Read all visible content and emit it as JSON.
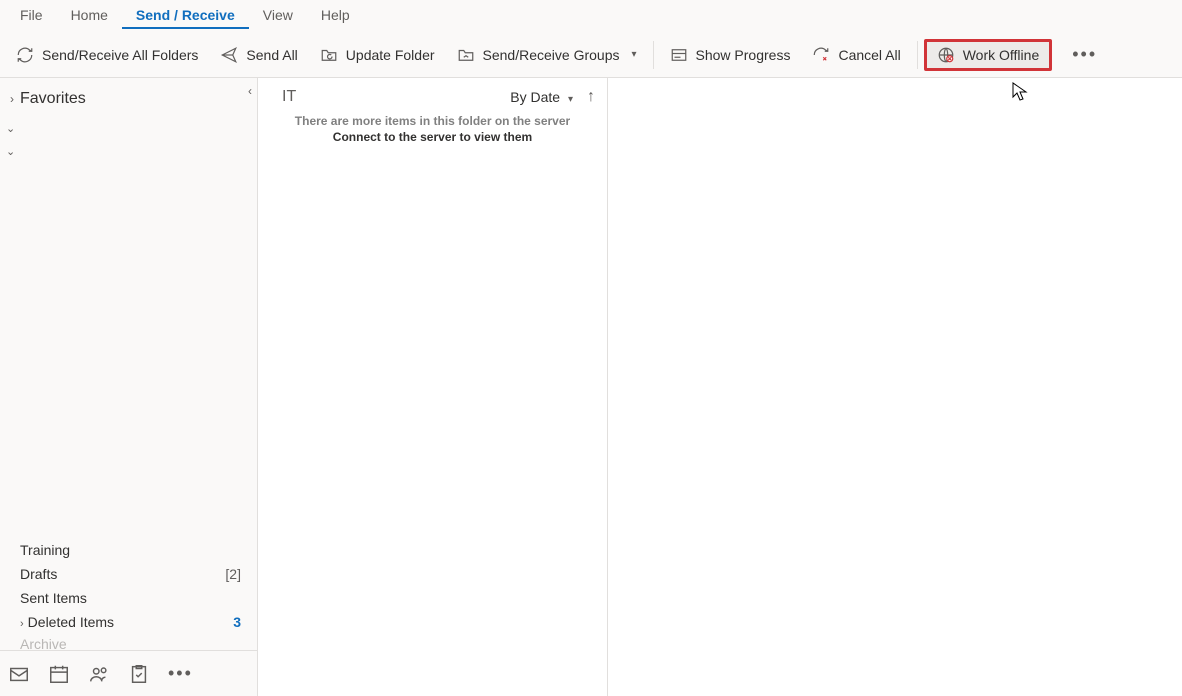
{
  "tabs": {
    "file": "File",
    "home": "Home",
    "send_receive": "Send / Receive",
    "view": "View",
    "help": "Help"
  },
  "ribbon": {
    "send_receive_all": "Send/Receive All Folders",
    "send_all": "Send All",
    "update_folder": "Update Folder",
    "sr_groups": "Send/Receive Groups",
    "show_progress": "Show Progress",
    "cancel_all": "Cancel All",
    "work_offline": "Work Offline"
  },
  "nav": {
    "favorites": "Favorites",
    "folders": {
      "training": "Training",
      "drafts": {
        "label": "Drafts",
        "count": "[2]"
      },
      "sent": "Sent Items",
      "deleted": {
        "label": "Deleted Items",
        "count": "3"
      },
      "archive": "Archive"
    }
  },
  "list": {
    "title": "IT",
    "sort": "By Date",
    "msg1": "There are more items in this folder on the server",
    "msg2": "Connect to the server to view them"
  }
}
